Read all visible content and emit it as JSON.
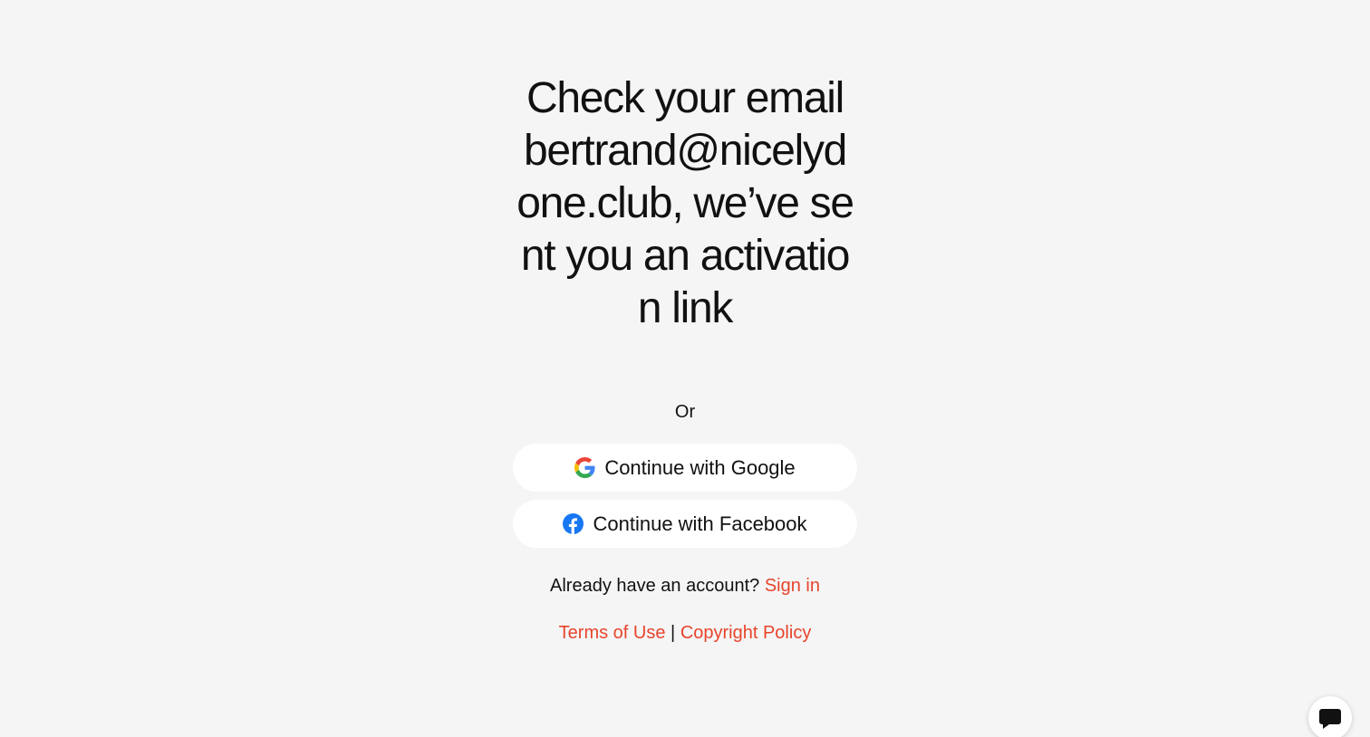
{
  "headline": "Check your email bertrand@nicelydone.club, we’ve sent you an activation link",
  "divider_text": "Or",
  "social": {
    "google_label": "Continue with Google",
    "facebook_label": "Continue with Facebook"
  },
  "account": {
    "prompt": "Already have an account?",
    "sign_in_label": "Sign in"
  },
  "legal": {
    "terms_label": "Terms of Use",
    "separator": "|",
    "copyright_label": "Copyright Policy"
  },
  "colors": {
    "background": "#f5f5f5",
    "link": "#e8442c",
    "facebook_blue": "#1877f2"
  },
  "icons": {
    "google": "google-icon",
    "facebook": "facebook-icon",
    "chat": "chat-bubble-icon"
  }
}
